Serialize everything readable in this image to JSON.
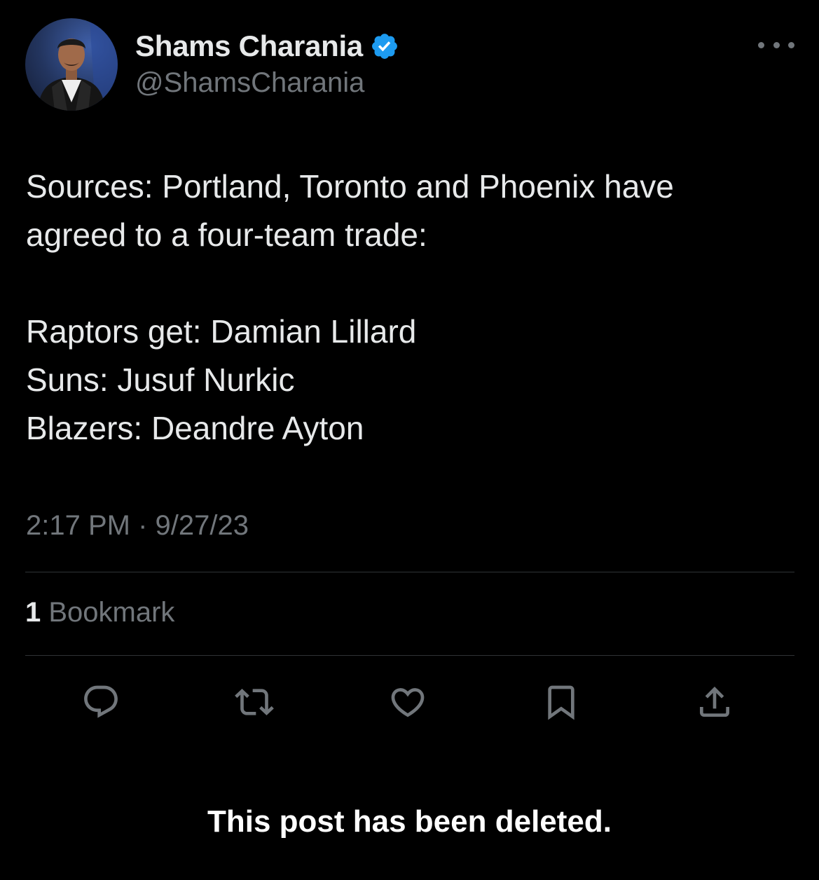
{
  "author": {
    "display_name": "Shams Charania",
    "handle": "@ShamsCharania",
    "verified_icon": "verified-badge-icon",
    "avatar_icon": "avatar-photo"
  },
  "post": {
    "text_lines": [
      "Sources: Portland, Toronto and Phoenix have",
      "agreed to a four-team trade:",
      "",
      "Raptors get: Damian Lillard",
      "Suns: Jusuf Nurkic",
      "Blazers: Deandre Ayton"
    ],
    "timestamp": "2:17 PM · 9/27/23"
  },
  "stats": {
    "bookmark_count": "1",
    "bookmark_label": "Bookmark"
  },
  "actions": [
    {
      "name": "reply",
      "icon": "reply-icon"
    },
    {
      "name": "repost",
      "icon": "repost-icon"
    },
    {
      "name": "like",
      "icon": "heart-icon"
    },
    {
      "name": "bookmark",
      "icon": "bookmark-icon"
    },
    {
      "name": "share",
      "icon": "share-icon"
    }
  ],
  "status_message": "This post has been deleted.",
  "colors": {
    "background": "#000000",
    "text_primary": "#e7e9ea",
    "text_secondary": "#71767b",
    "divider": "#2f3336",
    "verified_blue": "#1d9bf0"
  }
}
